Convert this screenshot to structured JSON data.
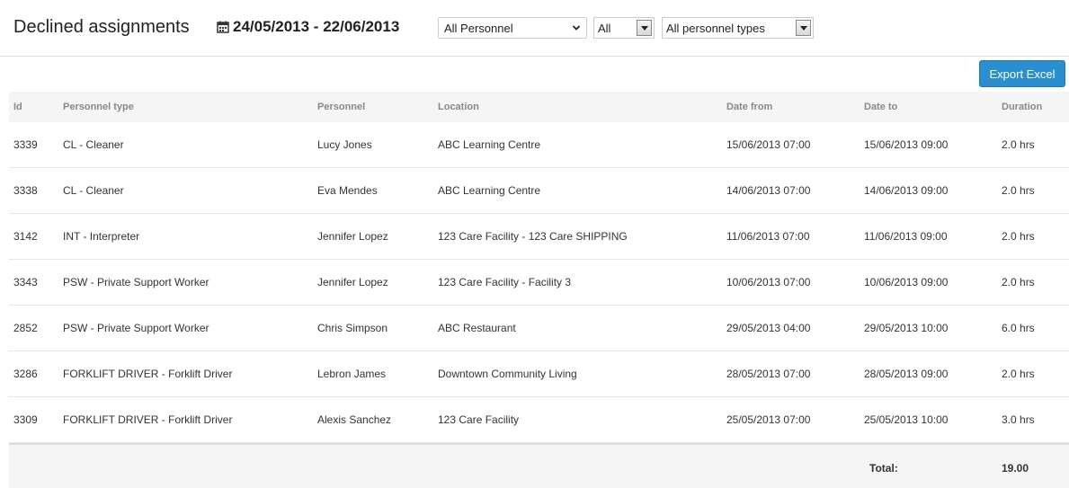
{
  "header": {
    "title": "Declined assignments",
    "date_range": "24/05/2013 - 22/06/2013"
  },
  "filters": {
    "personnel": "All Personnel",
    "status": "All",
    "personnel_types": "All personnel types"
  },
  "toolbar": {
    "export_label": "Export Excel"
  },
  "table": {
    "columns": [
      "Id",
      "Personnel type",
      "Personnel",
      "Location",
      "Date from",
      "Date to",
      "Duration"
    ],
    "rows": [
      {
        "id": "3339",
        "type": "CL - Cleaner",
        "personnel": "Lucy Jones",
        "location": "ABC Learning Centre",
        "from": "15/06/2013 07:00",
        "to": "15/06/2013 09:00",
        "duration": "2.0 hrs"
      },
      {
        "id": "3338",
        "type": "CL - Cleaner",
        "personnel": "Eva Mendes",
        "location": "ABC Learning Centre",
        "from": "14/06/2013 07:00",
        "to": "14/06/2013 09:00",
        "duration": "2.0 hrs"
      },
      {
        "id": "3142",
        "type": "INT - Interpreter",
        "personnel": "Jennifer Lopez",
        "location": "123 Care Facility - 123 Care SHIPPING",
        "from": "11/06/2013 07:00",
        "to": "11/06/2013 09:00",
        "duration": "2.0 hrs"
      },
      {
        "id": "3343",
        "type": "PSW - Private Support Worker",
        "personnel": "Jennifer Lopez",
        "location": "123 Care Facility - Facility 3",
        "from": "10/06/2013 07:00",
        "to": "10/06/2013 09:00",
        "duration": "2.0 hrs"
      },
      {
        "id": "2852",
        "type": "PSW - Private Support Worker",
        "personnel": "Chris Simpson",
        "location": "ABC Restaurant",
        "from": "29/05/2013 04:00",
        "to": "29/05/2013 10:00",
        "duration": "6.0 hrs"
      },
      {
        "id": "3286",
        "type": "FORKLIFT DRIVER - Forklift Driver",
        "personnel": "Lebron James",
        "location": "Downtown Community Living",
        "from": "28/05/2013 07:00",
        "to": "28/05/2013 09:00",
        "duration": "2.0 hrs"
      },
      {
        "id": "3309",
        "type": "FORKLIFT DRIVER - Forklift Driver",
        "personnel": "Alexis Sanchez",
        "location": "123 Care Facility",
        "from": "25/05/2013 07:00",
        "to": "25/05/2013 10:00",
        "duration": "3.0 hrs"
      }
    ],
    "total_label": "Total:",
    "total_value": "19.00"
  },
  "icons": {
    "calendar": "calendar-icon",
    "dropdown": "chevron-down-icon"
  },
  "colors": {
    "accent": "#2a8fd0"
  }
}
